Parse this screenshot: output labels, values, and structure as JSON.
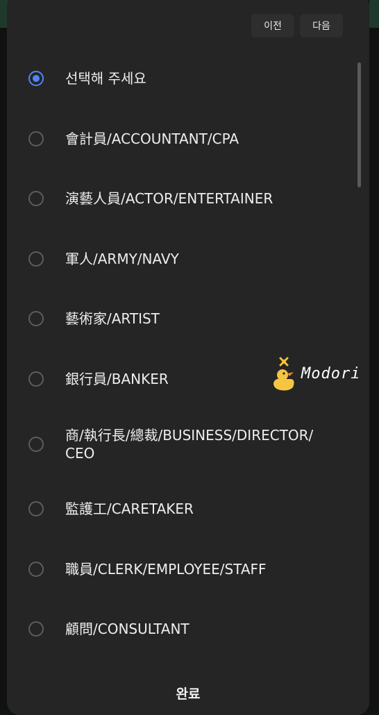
{
  "header": {
    "prev_label": "이전",
    "next_label": "다음"
  },
  "options": [
    {
      "label": "선택해 주세요",
      "checked": true
    },
    {
      "label": "會計員/ACCOUNTANT/CPA",
      "checked": false
    },
    {
      "label": "演藝人員/ACTOR/ENTERTAINER",
      "checked": false
    },
    {
      "label": "軍人/ARMY/NAVY",
      "checked": false
    },
    {
      "label": "藝術家/ARTIST",
      "checked": false
    },
    {
      "label": "銀行員/BANKER",
      "checked": false
    },
    {
      "label": "商/執行長/總裁/BUSINESS/DIRECTOR/ CEO",
      "checked": false
    },
    {
      "label": "監護工/CARETAKER",
      "checked": false
    },
    {
      "label": "職員/CLERK/EMPLOYEE/STAFF",
      "checked": false
    },
    {
      "label": "顧問/CONSULTANT",
      "checked": false
    }
  ],
  "footer": {
    "done_label": "완료"
  },
  "watermark": {
    "text": "Modori"
  },
  "colors": {
    "accent": "#4f86f7",
    "sheet_bg": "#252525",
    "text": "#eeeeee"
  }
}
